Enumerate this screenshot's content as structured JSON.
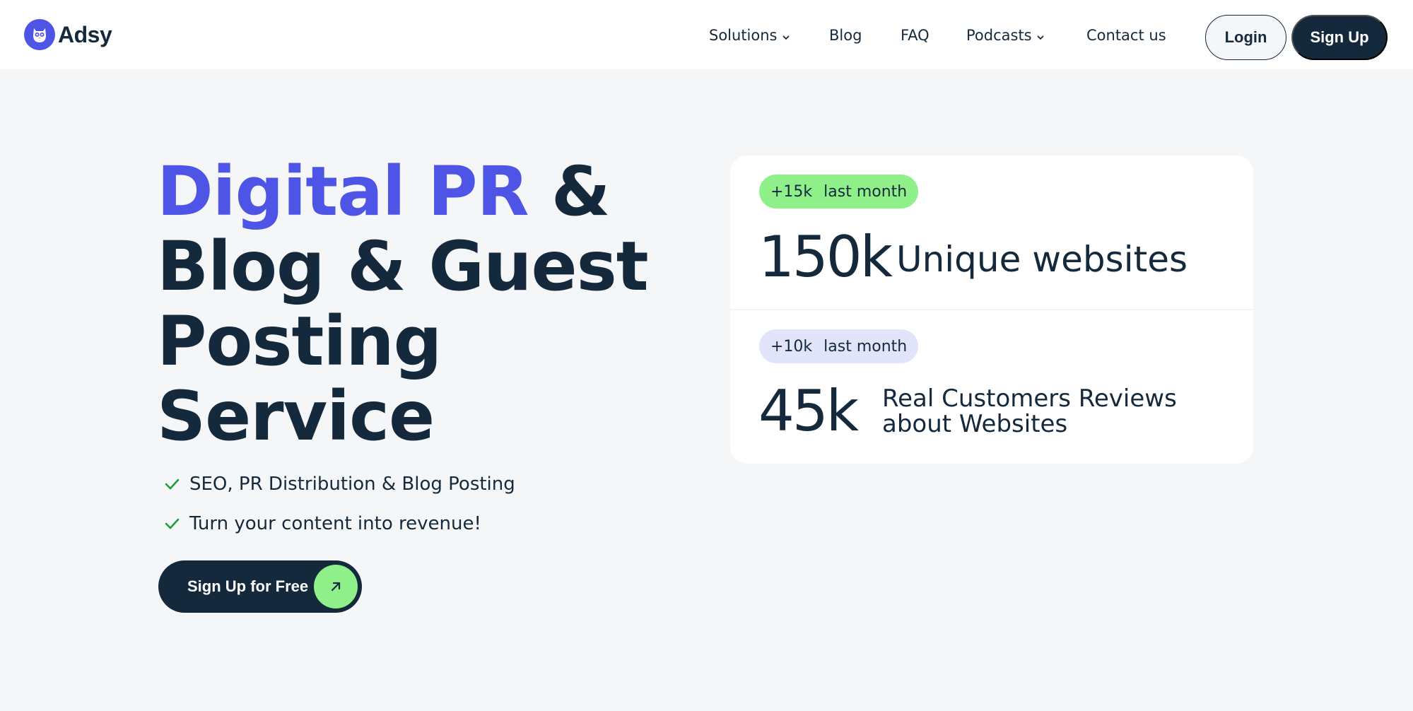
{
  "brand": {
    "name": "Adsy",
    "logo_icon": "owl-icon",
    "accent": "#4e55e6",
    "dark": "#15293d",
    "green": "#8ff08a"
  },
  "nav": {
    "items": [
      {
        "label": "Solutions",
        "has_dropdown": true
      },
      {
        "label": "Blog",
        "has_dropdown": false
      },
      {
        "label": "FAQ",
        "has_dropdown": false
      },
      {
        "label": "Podcasts",
        "has_dropdown": true
      },
      {
        "label": "Contact us",
        "has_dropdown": false
      }
    ],
    "login_label": "Login",
    "signup_label": "Sign Up"
  },
  "hero": {
    "title_accent": "Digital PR",
    "title_amp": " &",
    "title_line2": "Blog & Guest",
    "title_line3": "Posting",
    "title_line4": "Service",
    "features": [
      "SEO, PR Distribution & Blog Posting",
      "Turn your content into revenue!"
    ],
    "cta_label": "Sign Up for Free"
  },
  "stats": [
    {
      "delta": "+15k",
      "period": "last month",
      "number": "150k",
      "label": "Unique websites"
    },
    {
      "delta": "+10k",
      "period": "last month",
      "number": "45k",
      "label_line1": "Real Customers Reviews",
      "label_line2": "about Websites"
    }
  ]
}
